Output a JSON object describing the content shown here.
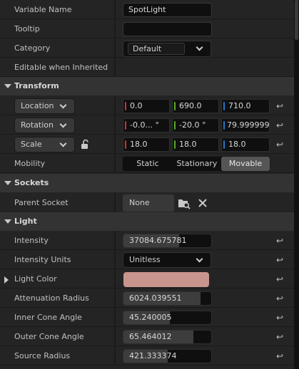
{
  "variable": {
    "name_label": "Variable Name",
    "name_value": "SpotLight",
    "tooltip_label": "Tooltip",
    "tooltip_value": "",
    "category_label": "Category",
    "category_value": "Default",
    "editable_label": "Editable when Inherited",
    "editable_checked": true
  },
  "transform": {
    "title": "Transform",
    "location_label": "Location",
    "location": [
      "0.0",
      "690.0",
      "710.0"
    ],
    "rotation_label": "Rotation",
    "rotation": [
      "-0.0... °",
      "-20.0 °",
      "79.999999"
    ],
    "scale_label": "Scale",
    "scale": [
      "18.0",
      "18.0",
      "18.0"
    ],
    "mobility_label": "Mobility",
    "mobility_options": [
      "Static",
      "Stationary",
      "Movable"
    ],
    "mobility_selected": "Movable"
  },
  "sockets": {
    "title": "Sockets",
    "parent_label": "Parent Socket",
    "parent_value": "None"
  },
  "light": {
    "title": "Light",
    "intensity_label": "Intensity",
    "intensity_value": "37084.675781",
    "units_label": "Intensity Units",
    "units_value": "Unitless",
    "color_label": "Light Color",
    "color_value": "#c8958d",
    "atten_label": "Attenuation Radius",
    "atten_value": "6024.039551",
    "inner_label": "Inner Cone Angle",
    "inner_value": "45.240005",
    "outer_label": "Outer Cone Angle",
    "outer_value": "65.464012",
    "source_label": "Source Radius",
    "source_value": "421.333374"
  },
  "colors": {
    "axis_x": "#c33",
    "axis_y": "#5a2",
    "axis_z": "#27c",
    "check": "#2c8cff"
  },
  "icons": {
    "reset": "reset-arrow-icon",
    "lock": "unlock-icon",
    "browse": "folder-search-icon",
    "clear": "close-icon"
  }
}
